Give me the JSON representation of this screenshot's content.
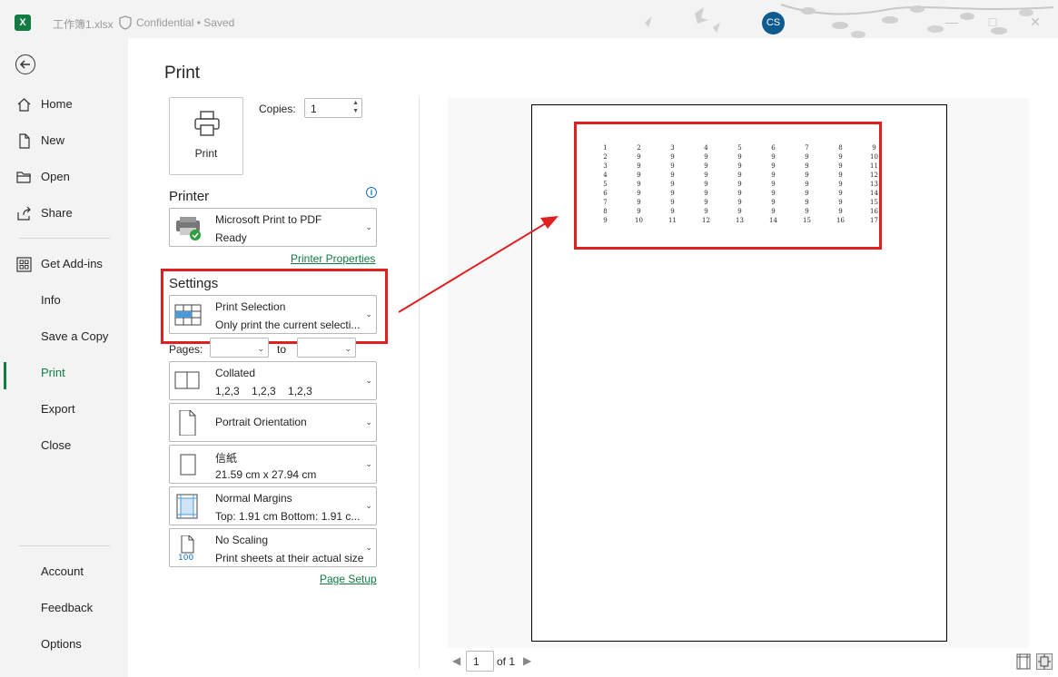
{
  "titlebar": {
    "file_name": "工作簿1.xlsx",
    "sensitivity": "Confidential",
    "save_state": "Saved",
    "avatar_initials": "CS",
    "app_letter": "X"
  },
  "nav": {
    "items": [
      {
        "label": "Home",
        "icon": "home-icon"
      },
      {
        "label": "New",
        "icon": "new-file-icon"
      },
      {
        "label": "Open",
        "icon": "folder-open-icon"
      },
      {
        "label": "Share",
        "icon": "share-icon"
      },
      {
        "label": "Get Add-ins",
        "icon": "add-ins-icon"
      },
      {
        "label": "Info",
        "icon": ""
      },
      {
        "label": "Save a Copy",
        "icon": ""
      },
      {
        "label": "Print",
        "icon": "",
        "active": true
      },
      {
        "label": "Export",
        "icon": ""
      },
      {
        "label": "Close",
        "icon": ""
      }
    ],
    "bottom_items": [
      {
        "label": "Account"
      },
      {
        "label": "Feedback"
      },
      {
        "label": "Options"
      }
    ]
  },
  "print": {
    "title": "Print",
    "print_button_label": "Print",
    "copies_label": "Copies:",
    "copies_value": "1",
    "printer_section": "Printer",
    "printer_name": "Microsoft Print to PDF",
    "printer_status": "Ready",
    "printer_properties_link": "Printer Properties",
    "settings_section": "Settings",
    "selection_title": "Print Selection",
    "selection_desc": "Only print the current selecti...",
    "pages_label": "Pages:",
    "to_label": "to",
    "collated_title": "Collated",
    "collated_desc": "1,2,3    1,2,3    1,2,3",
    "orientation_title": "Portrait Orientation",
    "paper_title": "信紙",
    "paper_desc": "21.59 cm x 27.94 cm",
    "margins_title": "Normal Margins",
    "margins_desc": "Top: 1.91 cm Bottom: 1.91 c...",
    "scaling_title": "No Scaling",
    "scaling_desc": "Print sheets at their actual size",
    "scaling_icon_text": "100",
    "page_setup_link": "Page Setup"
  },
  "preview": {
    "current_page": "1",
    "of_label": "of 1",
    "rows": [
      [
        "1",
        "2",
        "3",
        "4",
        "5",
        "6",
        "7",
        "8",
        "9"
      ],
      [
        "2",
        "9",
        "9",
        "9",
        "9",
        "9",
        "9",
        "9",
        "10"
      ],
      [
        "3",
        "9",
        "9",
        "9",
        "9",
        "9",
        "9",
        "9",
        "11"
      ],
      [
        "4",
        "9",
        "9",
        "9",
        "9",
        "9",
        "9",
        "9",
        "12"
      ],
      [
        "5",
        "9",
        "9",
        "9",
        "9",
        "9",
        "9",
        "9",
        "13"
      ],
      [
        "6",
        "9",
        "9",
        "9",
        "9",
        "9",
        "9",
        "9",
        "14"
      ],
      [
        "7",
        "9",
        "9",
        "9",
        "9",
        "9",
        "9",
        "9",
        "15"
      ],
      [
        "8",
        "9",
        "9",
        "9",
        "9",
        "9",
        "9",
        "9",
        "16"
      ],
      [
        "9",
        "10",
        "11",
        "12",
        "13",
        "14",
        "15",
        "16",
        "17"
      ]
    ]
  },
  "colors": {
    "accent": "#107c41",
    "highlight": "#e02020"
  }
}
